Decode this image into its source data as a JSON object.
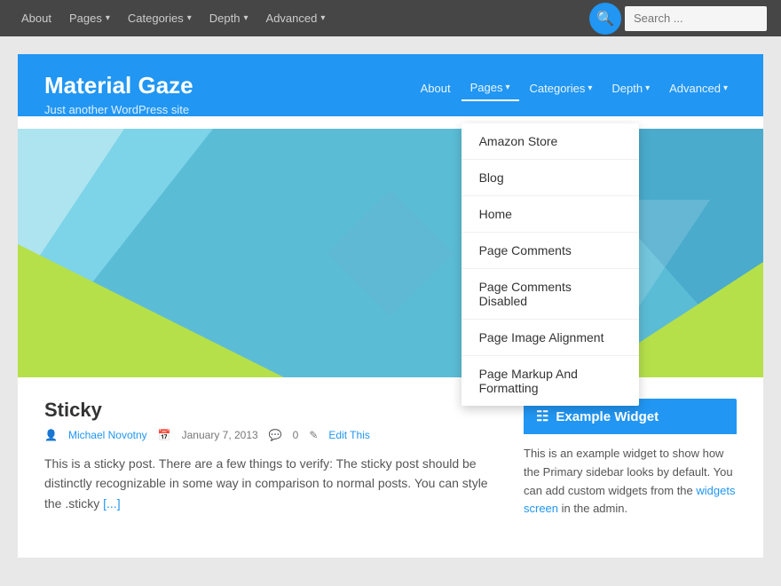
{
  "admin_bar": {
    "nav_items": [
      {
        "label": "About",
        "has_dropdown": false
      },
      {
        "label": "Pages",
        "has_dropdown": true
      },
      {
        "label": "Categories",
        "has_dropdown": true
      },
      {
        "label": "Depth",
        "has_dropdown": true
      },
      {
        "label": "Advanced",
        "has_dropdown": true
      }
    ],
    "search_placeholder": "Search ..."
  },
  "site_header": {
    "title": "Material Gaze",
    "tagline": "Just another WordPress site",
    "nav_items": [
      {
        "label": "About",
        "has_dropdown": false
      },
      {
        "label": "Pages",
        "has_dropdown": true,
        "active": true
      },
      {
        "label": "Categories",
        "has_dropdown": true
      },
      {
        "label": "Depth",
        "has_dropdown": true
      },
      {
        "label": "Advanced",
        "has_dropdown": true
      }
    ]
  },
  "pages_dropdown": {
    "items": [
      "Amazon Store",
      "Blog",
      "Home",
      "Page Comments",
      "Page Comments Disabled",
      "Page Image Alignment",
      "Page Markup And Formatting"
    ]
  },
  "post": {
    "title": "Sticky",
    "author": "Michael Novotny",
    "date": "January 7, 2013",
    "comments": "0",
    "edit_label": "Edit This",
    "excerpt": "This is a sticky post. There are a few things to verify: The sticky post should be distinctly recognizable in some way in comparison to normal posts. You can style the .sticky",
    "read_more": "[...]"
  },
  "sidebar": {
    "widget_title": "Example Widget",
    "widget_body_text": "This is an example widget to show how the Primary sidebar looks by default. You can add custom widgets from the",
    "widget_link_text": "widgets screen",
    "widget_body_after": " in the admin."
  }
}
